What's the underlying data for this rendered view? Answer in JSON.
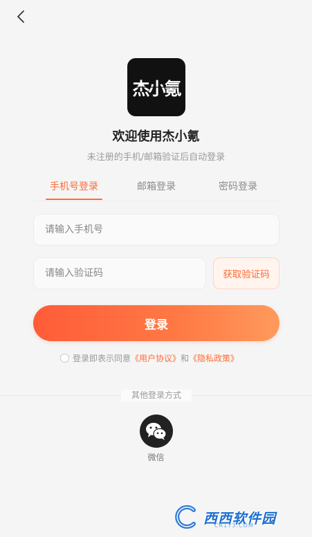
{
  "header": {
    "back_icon": "chevron-left-icon"
  },
  "app": {
    "logo_text": "杰小氪",
    "welcome": "欢迎使用杰小氪",
    "subtitle": "未注册的手机/邮箱验证后自动登录"
  },
  "tabs": [
    {
      "label": "手机号登录",
      "active": true
    },
    {
      "label": "邮箱登录",
      "active": false
    },
    {
      "label": "密码登录",
      "active": false
    }
  ],
  "form": {
    "phone_placeholder": "请输入手机号",
    "phone_value": "",
    "code_placeholder": "请输入验证码",
    "code_value": "",
    "get_code_label": "获取验证码",
    "login_label": "登录"
  },
  "agreement": {
    "checked": false,
    "prefix": "登录即表示同意",
    "user_agreement": "《用户协议》",
    "and": "和",
    "privacy_policy": "《隐私政策》"
  },
  "other_login": {
    "title": "其他登录方式",
    "wechat_label": "微信",
    "wechat_icon": "wechat-icon"
  },
  "colors": {
    "accent": "#ff6b35",
    "button_start": "#ff5c38",
    "button_end": "#ff9a5c"
  },
  "watermark": {
    "text": "西西软件园",
    "url": "CR173.COM"
  }
}
